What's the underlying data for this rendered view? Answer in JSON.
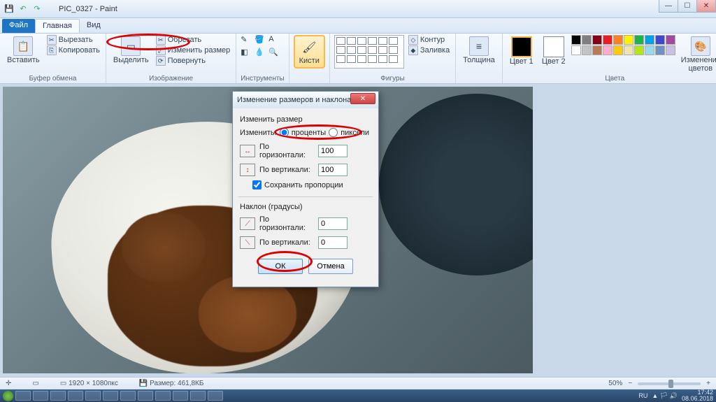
{
  "title": "PIC_0327 - Paint",
  "tabs": {
    "file": "Файл",
    "home": "Главная",
    "view": "Вид"
  },
  "ribbon": {
    "clipboard": {
      "paste": "Вставить",
      "cut": "Вырезать",
      "copy": "Копировать",
      "label": "Буфер обмена"
    },
    "image": {
      "select": "Выделить",
      "crop": "Обрезать",
      "resize": "Изменить размер",
      "rotate": "Повернуть",
      "label": "Изображение"
    },
    "tools": {
      "label": "Инструменты"
    },
    "brushes": {
      "btn": "Кисти"
    },
    "shapes": {
      "outline": "Контур",
      "fill": "Заливка",
      "label": "Фигуры"
    },
    "thickness": "Толщина",
    "color1": "Цвет 1",
    "color2": "Цвет 2",
    "editcolors": "Изменение цветов",
    "colors_label": "Цвета"
  },
  "dialog": {
    "title": "Изменение размеров и наклона",
    "resize_group": "Изменить размер",
    "by_label": "Изменить:",
    "percent": "проценты",
    "pixels": "пиксели",
    "horizontal": "По горизонтали:",
    "vertical": "По вертикали:",
    "h_value": "100",
    "v_value": "100",
    "keep_aspect": "Сохранить пропорции",
    "skew_group": "Наклон (градусы)",
    "skew_h": "0",
    "skew_v": "0",
    "ok": "ОК",
    "cancel": "Отмена"
  },
  "status": {
    "dims": "1920 × 1080пкс",
    "size_label": "Размер: 461,8КБ",
    "zoom": "50%"
  },
  "tray": {
    "lang": "RU",
    "time": "17:42",
    "date": "08.06.2018"
  },
  "palette": [
    "#000",
    "#7f7f7f",
    "#880015",
    "#ed1c24",
    "#ff7f27",
    "#fff200",
    "#22b14c",
    "#00a2e8",
    "#3f48cc",
    "#a349a4",
    "#fff",
    "#c3c3c3",
    "#b97a57",
    "#ffaec9",
    "#ffc90e",
    "#efe4b0",
    "#b5e61d",
    "#99d9ea",
    "#7092be",
    "#c8bfe7"
  ]
}
